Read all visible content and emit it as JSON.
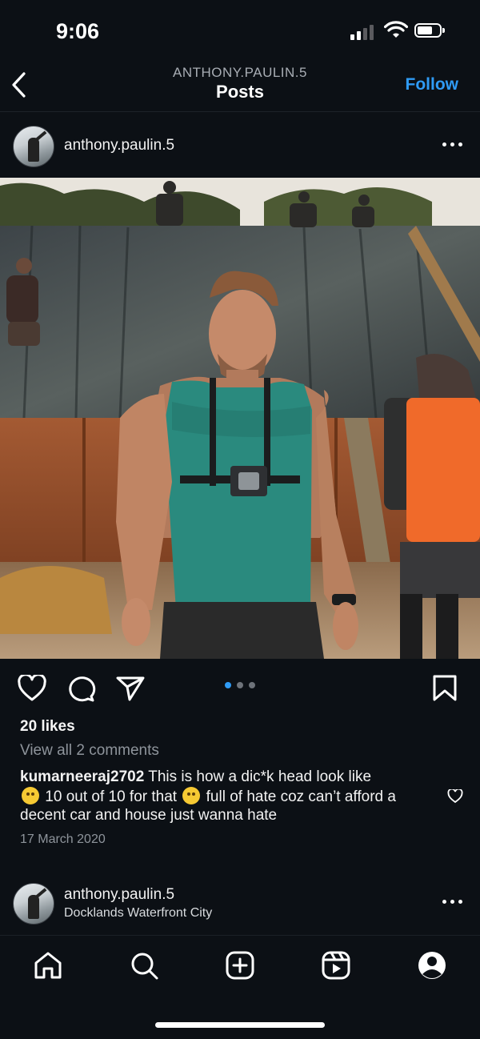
{
  "status": {
    "time": "9:06"
  },
  "header": {
    "subtitle": "ANTHONY.PAULIN.5",
    "title": "Posts",
    "follow_label": "Follow"
  },
  "post": {
    "username": "anthony.paulin.5",
    "likes": "20 likes",
    "view_comments": "View all 2 comments",
    "comment": {
      "author": "kumarneeraj2702",
      "text_1": "This is how a dic*k head look like",
      "text_2": "10 out of 10 for that",
      "text_3": "full of hate coz can’t afford a decent car and house just wanna hate"
    },
    "date": "17 March 2020",
    "carousel": {
      "count": 3,
      "active": 1
    }
  },
  "next_post": {
    "username": "anthony.paulin.5",
    "location": "Docklands Waterfront City"
  },
  "icons": {
    "back": "chevron-left-icon",
    "more": "more-horizontal-icon",
    "like": "heart-icon",
    "comment": "comment-icon",
    "share": "send-icon",
    "save": "bookmark-icon",
    "nav": [
      "home-icon",
      "search-icon",
      "create-icon",
      "reels-icon",
      "profile-icon"
    ]
  },
  "colors": {
    "background": "#0c1015",
    "accent": "#2f9bf5",
    "muted": "#8e949b"
  }
}
